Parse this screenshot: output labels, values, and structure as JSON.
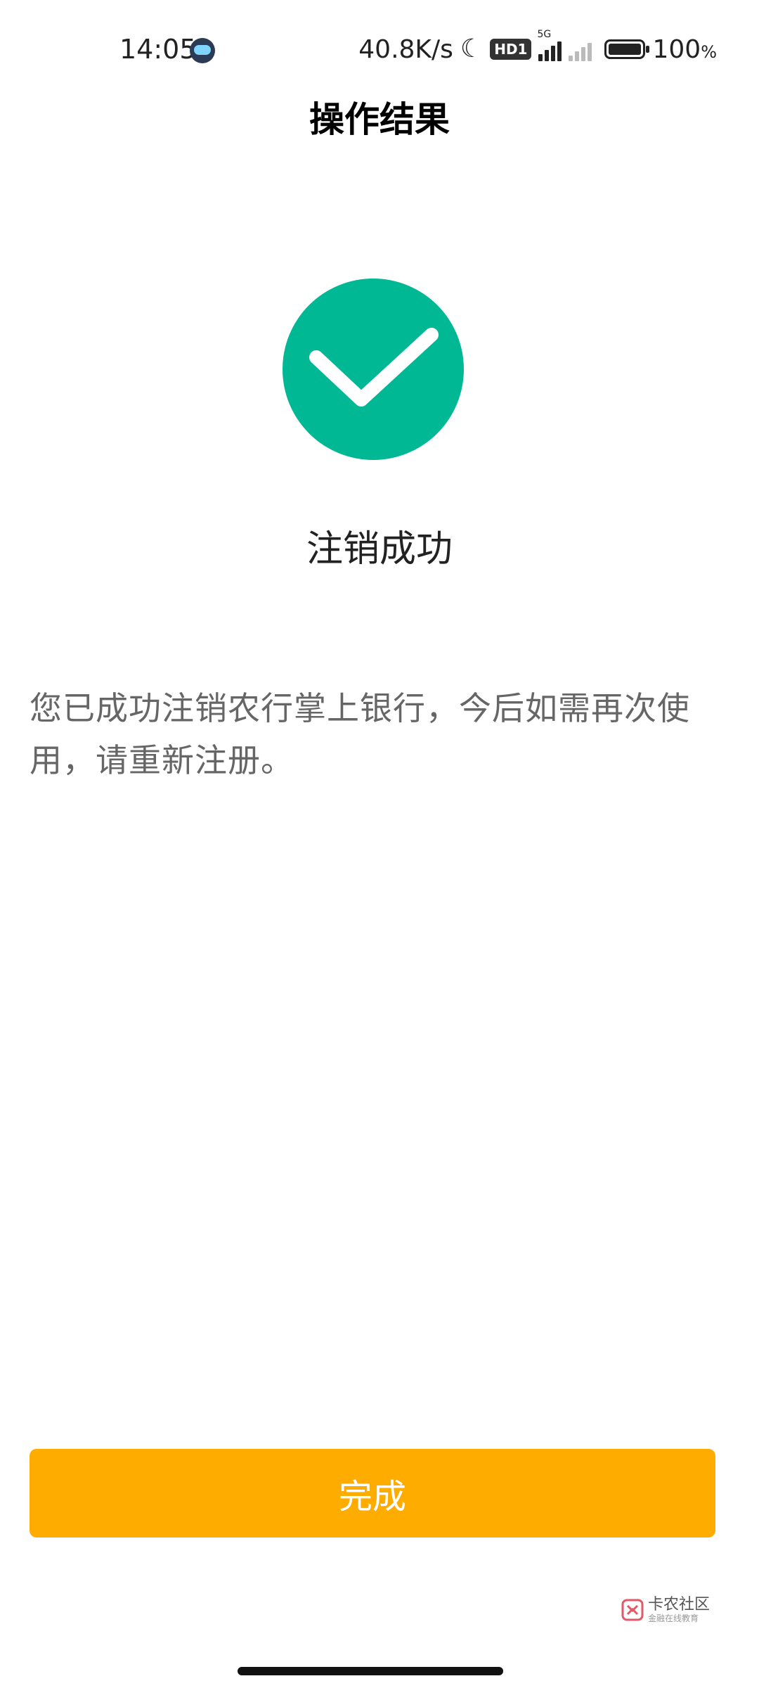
{
  "status_bar": {
    "time": "14:05",
    "net_speed": "40.8K/s",
    "hd_label": "HD1",
    "network_label": "5G",
    "battery_percent": "100",
    "battery_unit": "%"
  },
  "header": {
    "title": "操作结果"
  },
  "result": {
    "title": "注销成功",
    "description": "您已成功注销农行掌上银行，今后如需再次使用，请重新注册。",
    "icon": "check-circle-icon",
    "icon_color": "#00b894"
  },
  "actions": {
    "done_label": "完成",
    "done_color": "#ffac00"
  },
  "watermark": {
    "title": "卡农社区",
    "subtitle": "金融在线教育"
  }
}
